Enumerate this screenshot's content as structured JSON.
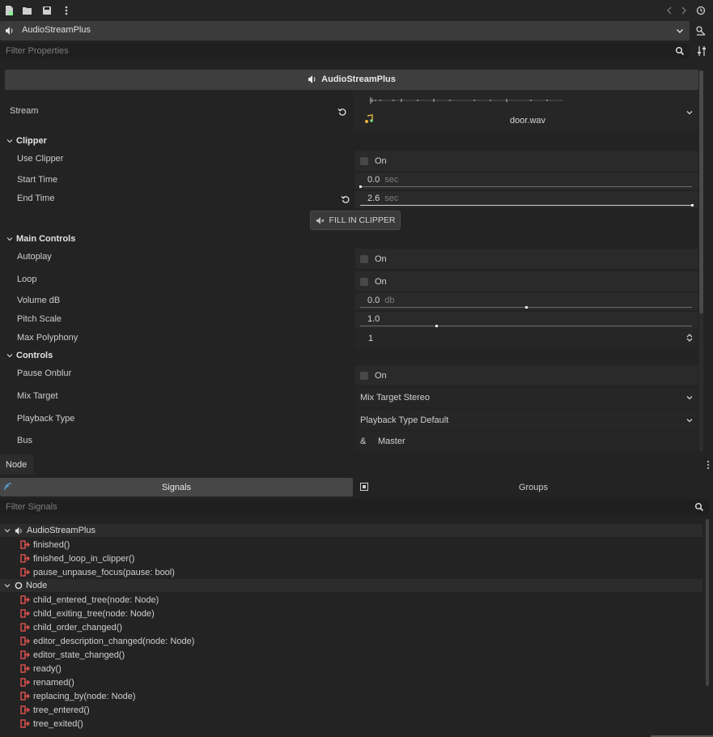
{
  "resource": {
    "name": "AudioStreamPlus"
  },
  "filter_properties": {
    "placeholder": "Filter Properties"
  },
  "inspector": {
    "header": "AudioStreamPlus",
    "stream": {
      "label": "Stream",
      "file": "door.wav"
    },
    "clipper": {
      "title": "Clipper",
      "use_clipper": {
        "label": "Use Clipper",
        "value": "On",
        "checked": false
      },
      "start_time": {
        "label": "Start Time",
        "value": "0.0",
        "unit": "sec",
        "fraction": 0.0
      },
      "end_time": {
        "label": "End Time",
        "value": "2.6",
        "unit": "sec",
        "fraction": 1.0
      },
      "fill_button": "FILL IN CLIPPER"
    },
    "main_controls": {
      "title": "Main Controls",
      "autoplay": {
        "label": "Autoplay",
        "value": "On",
        "checked": false
      },
      "loop": {
        "label": "Loop",
        "value": "On",
        "checked": false
      },
      "volume": {
        "label": "Volume dB",
        "value": "0.0",
        "unit": "db",
        "fraction": 0.5
      },
      "pitch": {
        "label": "Pitch Scale",
        "value": "1.0",
        "fraction": 0.23
      },
      "max_polyphony": {
        "label": "Max Polyphony",
        "value": "1"
      }
    },
    "controls": {
      "title": "Controls",
      "pause_onblur": {
        "label": "Pause Onblur",
        "value": "On",
        "checked": false
      },
      "mix_target": {
        "label": "Mix Target",
        "value": "Mix Target Stereo"
      },
      "playback_type": {
        "label": "Playback Type",
        "value": "Playback Type Default"
      },
      "bus": {
        "label": "Bus",
        "prefix": "&",
        "value": "Master"
      }
    }
  },
  "bottom": {
    "tab": "Node",
    "subtabs": {
      "signals": "Signals",
      "groups": "Groups"
    },
    "filter_placeholder": "Filter Signals",
    "groups": [
      {
        "name": "AudioStreamPlus",
        "signals": [
          "finished()",
          "finished_loop_in_clipper()",
          "pause_unpause_focus(pause: bool)"
        ]
      },
      {
        "name": "Node",
        "signals": [
          "child_entered_tree(node: Node)",
          "child_exiting_tree(node: Node)",
          "child_order_changed()",
          "editor_description_changed(node: Node)",
          "editor_state_changed()",
          "ready()",
          "renamed()",
          "replacing_by(node: Node)",
          "tree_entered()",
          "tree_exited()"
        ]
      }
    ]
  },
  "colors": {
    "signal_icon": "#e0524f",
    "stream_icon": "#e5b23a",
    "accent": "#57a7e0"
  }
}
